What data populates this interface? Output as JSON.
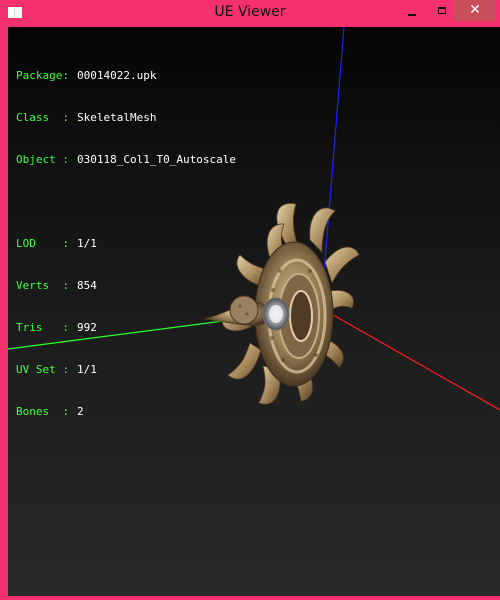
{
  "window": {
    "title": "UE Viewer",
    "minimize_icon": "minimize-icon",
    "maximize_icon": "maximize-icon",
    "close_label": "✕"
  },
  "info": {
    "package_label": "Package:",
    "package_value": "00014022.upk",
    "class_label": "Class  :",
    "class_value": "SkeletalMesh",
    "object_label": "Object :",
    "object_value": "030118_Col1_T0_Autoscale",
    "lod_label": "LOD    :",
    "lod_value": "1/1",
    "verts_label": "Verts  :",
    "verts_value": "854",
    "tris_label": "Tris   :",
    "tris_value": "992",
    "uvset_label": "UV Set :",
    "uvset_value": "1/1",
    "bones_label": "Bones  :",
    "bones_value": "2"
  },
  "colors": {
    "titlebar": "#f5306f",
    "close": "#c94f5d",
    "label": "#3dff3d",
    "axis_x": "#ff1f1f",
    "axis_y": "#2bff2b",
    "axis_z": "#1f1fff"
  }
}
